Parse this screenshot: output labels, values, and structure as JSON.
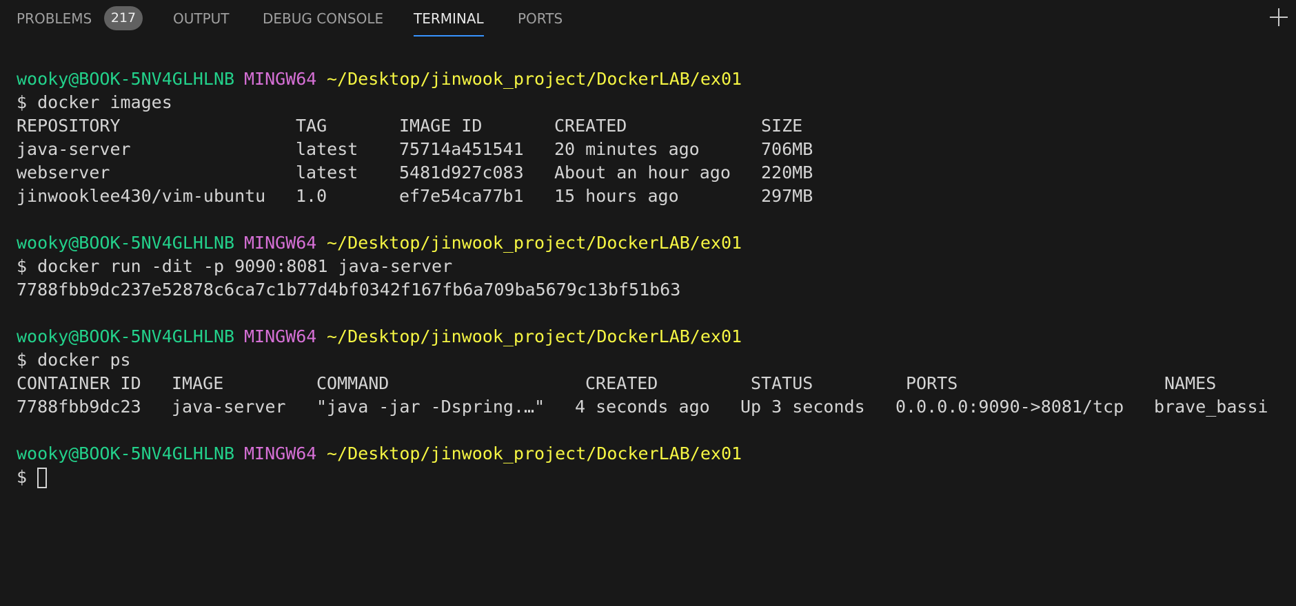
{
  "panel": {
    "tabs": [
      {
        "label": "PROBLEMS"
      },
      {
        "label": "OUTPUT"
      },
      {
        "label": "DEBUG CONSOLE"
      },
      {
        "label": "TERMINAL"
      },
      {
        "label": "PORTS"
      }
    ],
    "problems_count": "217",
    "active_tab": "TERMINAL",
    "add_icon": "plus-icon"
  },
  "terminal": {
    "prompt": {
      "user": "wooky@BOOK-5NV4GLHLNB",
      "env": "MINGW64",
      "path": "~/Desktop/jinwook_project/DockerLAB/ex01",
      "symbol": "$"
    },
    "cmd_images": "$ docker images",
    "images_headers": [
      "REPOSITORY",
      "TAG",
      "IMAGE ID",
      "CREATED",
      "SIZE"
    ],
    "images_rows": [
      [
        "java-server",
        "latest",
        "75714a451541",
        "20 minutes ago",
        "706MB"
      ],
      [
        "webserver",
        "latest",
        "5481d927c083",
        "About an hour ago",
        "220MB"
      ],
      [
        "jinwooklee430/vim-ubuntu",
        "1.0",
        "ef7e54ca77b1",
        "15 hours ago",
        "297MB"
      ]
    ],
    "cmd_run": "$ docker run -dit -p 9090:8081 java-server",
    "run_output": "7788fbb9dc237e52878c6ca7c1b77d4bf0342f167fb6a709ba5679c13bf51b63",
    "cmd_ps": "$ docker ps",
    "ps_headers": [
      "CONTAINER ID",
      "IMAGE",
      "COMMAND",
      "CREATED",
      "STATUS",
      "PORTS",
      "NAMES"
    ],
    "ps_rows": [
      [
        "7788fbb9dc23",
        "java-server",
        "\"java -jar -Dspring.…\"",
        "4 seconds ago",
        "Up 3 seconds",
        "0.0.0.0:9090->8081/tcp",
        "brave_bassi"
      ]
    ]
  },
  "colors": {
    "background": "#181818",
    "prompt_user": "#23d18b",
    "prompt_env": "#d670d6",
    "prompt_path": "#f5f543",
    "active_tab_underline": "#3794ff"
  }
}
